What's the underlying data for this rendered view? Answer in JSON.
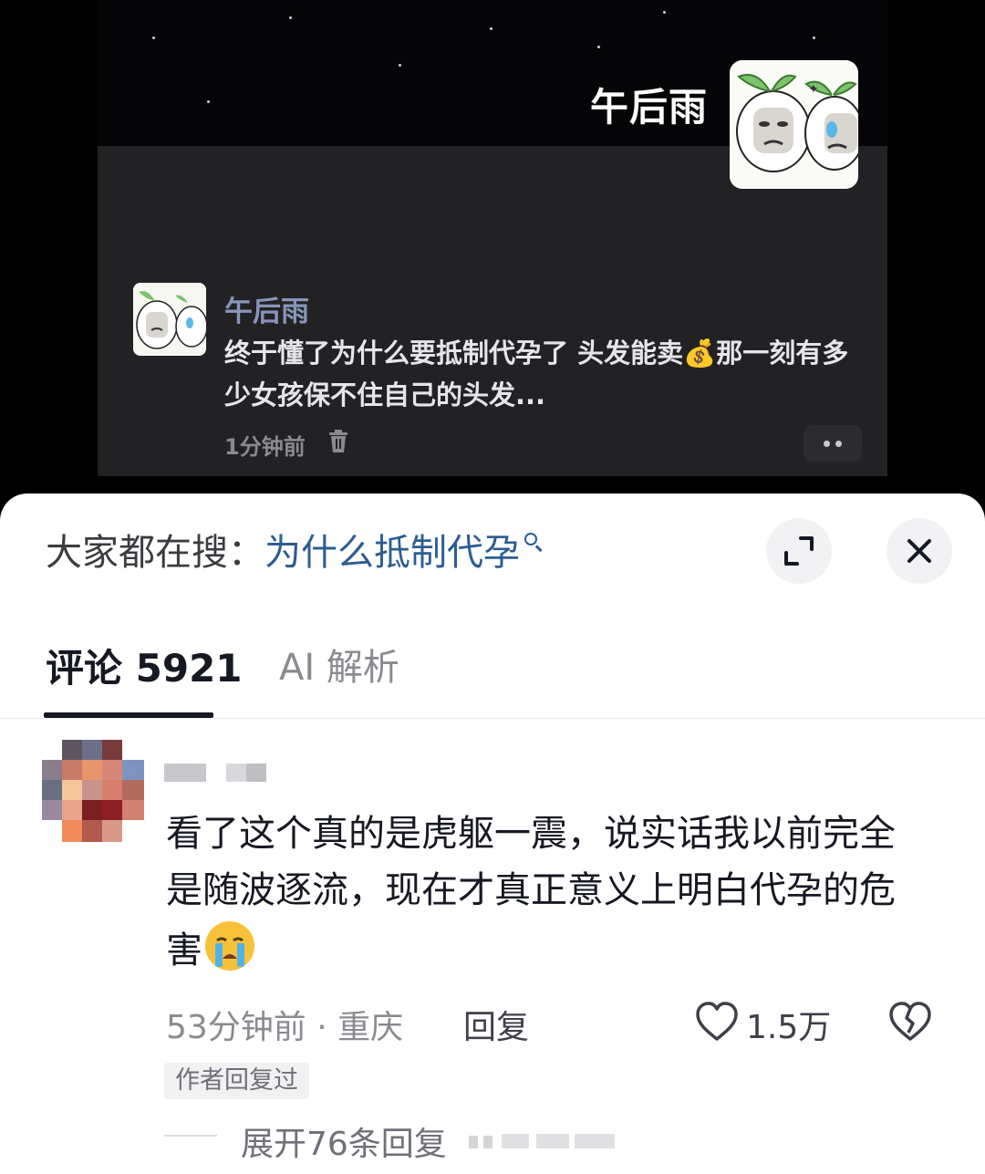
{
  "video": {
    "overlay_title": "午后雨",
    "post": {
      "author": "午后雨",
      "text": "终于懂了为什么要抵制代孕了 头发能卖💰那一刻有多少女孩保不住自己的头发...",
      "time": "1分钟前"
    }
  },
  "sheet": {
    "search": {
      "prefix": "大家都在搜：",
      "query": "为什么抵制代孕"
    },
    "tabs": [
      {
        "label": "评论 5921",
        "active": true
      },
      {
        "label": "AI 解析",
        "active": false
      }
    ],
    "comment": {
      "text": "看了这个真的是虎躯一震，说实话我以前完全是随波逐流，现在才真正意义上明白代孕的危害",
      "emoji": "crying-face",
      "meta": "53分钟前 · 重庆",
      "reply_label": "回复",
      "like_count": "1.5万",
      "author_badge": "作者回复过",
      "expand_label": "展开76条回复"
    }
  },
  "colors": {
    "search_query": "#2c5d91",
    "post_author": "#8795b8",
    "primary_text": "#161823",
    "secondary_text": "#8a8b91"
  }
}
